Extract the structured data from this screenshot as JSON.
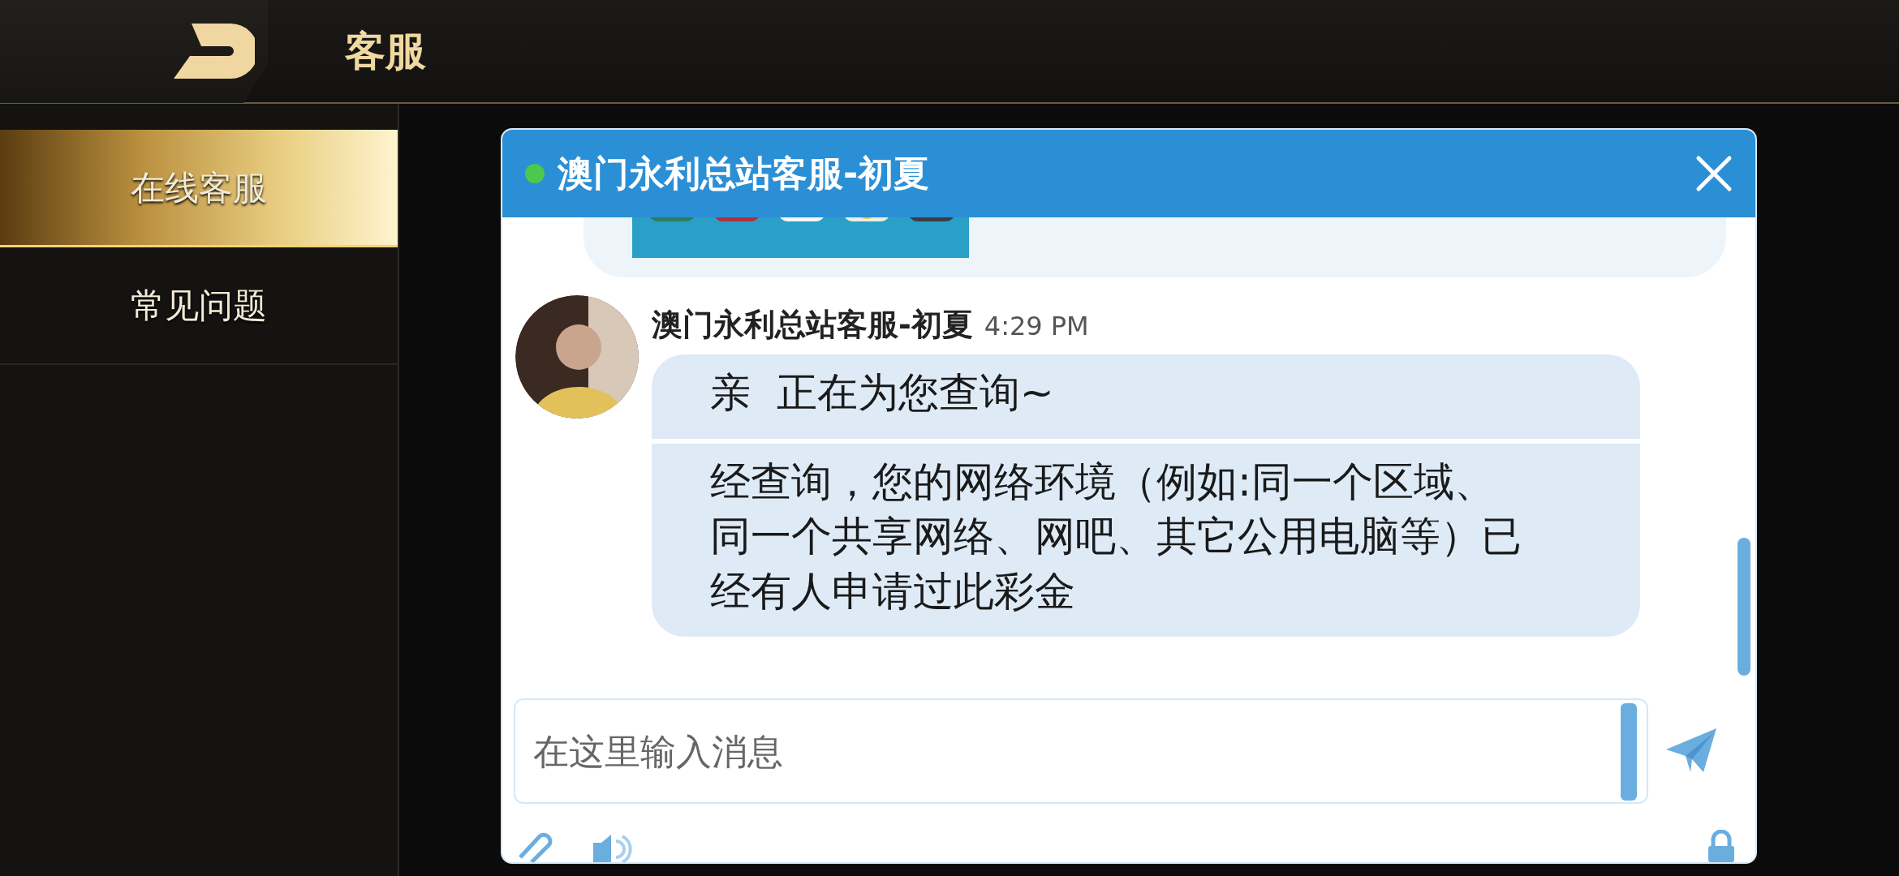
{
  "header": {
    "title": "客服"
  },
  "sidebar": {
    "items": [
      {
        "label": "在线客服",
        "selected": true
      },
      {
        "label": "常见问题",
        "selected": false
      }
    ]
  },
  "chat": {
    "title": "澳门永利总站客服-初夏",
    "online": true,
    "messages": [
      {
        "kind": "picture"
      },
      {
        "kind": "text",
        "sender": "澳门永利总站客服-初夏",
        "time": "4:29 PM",
        "parts": [
          "亲  正在为您查询~",
          "经查询，您的网络环境（例如:同一个区域、同一个共享网络、网吧、其它公用电脑等）已经有人申请过此彩金"
        ]
      }
    ],
    "input": {
      "placeholder": "在这里输入消息"
    }
  }
}
